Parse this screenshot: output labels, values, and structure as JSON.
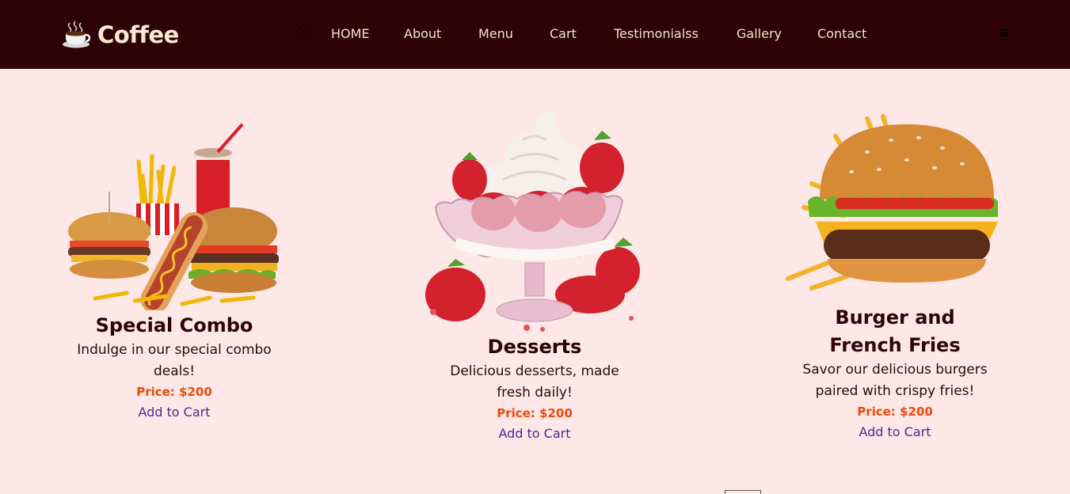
{
  "navbar": {
    "brand_icon": "coffee-cup-icon",
    "brand_text": "Coffee",
    "close_icon": "close-icon",
    "close_glyph": "✕",
    "links": [
      {
        "label": "HOME"
      },
      {
        "label": "About"
      },
      {
        "label": "Menu"
      },
      {
        "label": "Cart"
      },
      {
        "label": "Testimonialss"
      },
      {
        "label": "Gallery"
      },
      {
        "label": "Contact"
      }
    ],
    "menu_icon": "hamburger-icon"
  },
  "menu_items": [
    {
      "image": "combo-meal-image",
      "title": "Special Combo",
      "description": "Indulge in our special combo deals!",
      "price": "Price: $200",
      "cta": "Add to Cart"
    },
    {
      "image": "strawberry-dessert-image",
      "title": "Desserts",
      "description": "Delicious desserts, made fresh daily!",
      "price": "Price: $200",
      "cta": "Add to Cart"
    },
    {
      "image": "burger-fries-image",
      "title": "Burger and French Fries",
      "description": "Savor our delicious burgers paired with crispy fries!",
      "price": "Price: $200",
      "cta": "Add to Cart"
    }
  ],
  "colors": {
    "navbar_bg": "#2d0305",
    "page_bg": "#fde7e7",
    "brand_text": "#fde9cf",
    "nav_text": "#f5e1c8",
    "price": "#f04a0b",
    "link": "#4b2b8f"
  }
}
